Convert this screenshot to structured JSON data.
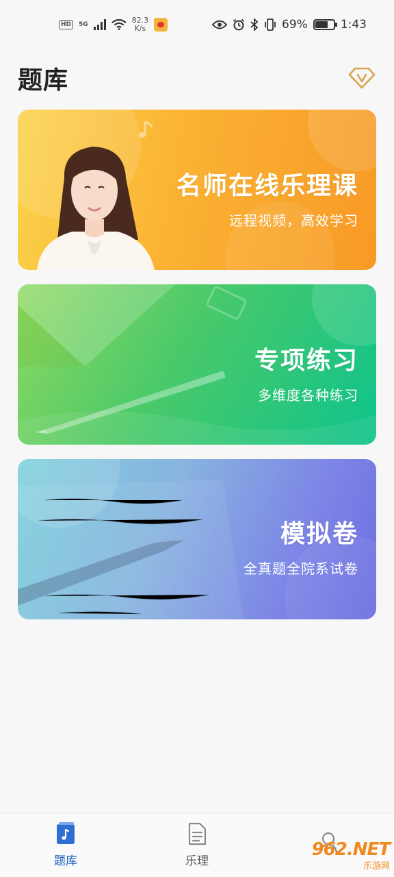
{
  "status_bar": {
    "hd": "HD",
    "network": "5G",
    "speed_value": "82.3",
    "speed_unit": "K/s",
    "battery": "69%",
    "battery_level": 0.69,
    "time": "1:43"
  },
  "header": {
    "title": "题库",
    "vip_icon": "diamond-v-icon"
  },
  "cards": [
    {
      "title": "名师在线乐理课",
      "subtitle": "远程视频，高效学习",
      "color": "#f9a82c"
    },
    {
      "title": "专项练习",
      "subtitle": "多维度各种练习",
      "color": "#2cc67a"
    },
    {
      "title": "模拟卷",
      "subtitle": "全真题全院系试卷",
      "color": "#7a8ee2"
    }
  ],
  "bottom_nav": {
    "items": [
      {
        "label": "题库",
        "icon": "music-book-icon",
        "active": true
      },
      {
        "label": "乐理",
        "icon": "document-icon",
        "active": false
      },
      {
        "label": "",
        "icon": "user-icon",
        "active": false
      }
    ],
    "active_color": "#1b5fbd"
  },
  "watermark": {
    "logo": "962.NET",
    "sub": "乐游网"
  }
}
